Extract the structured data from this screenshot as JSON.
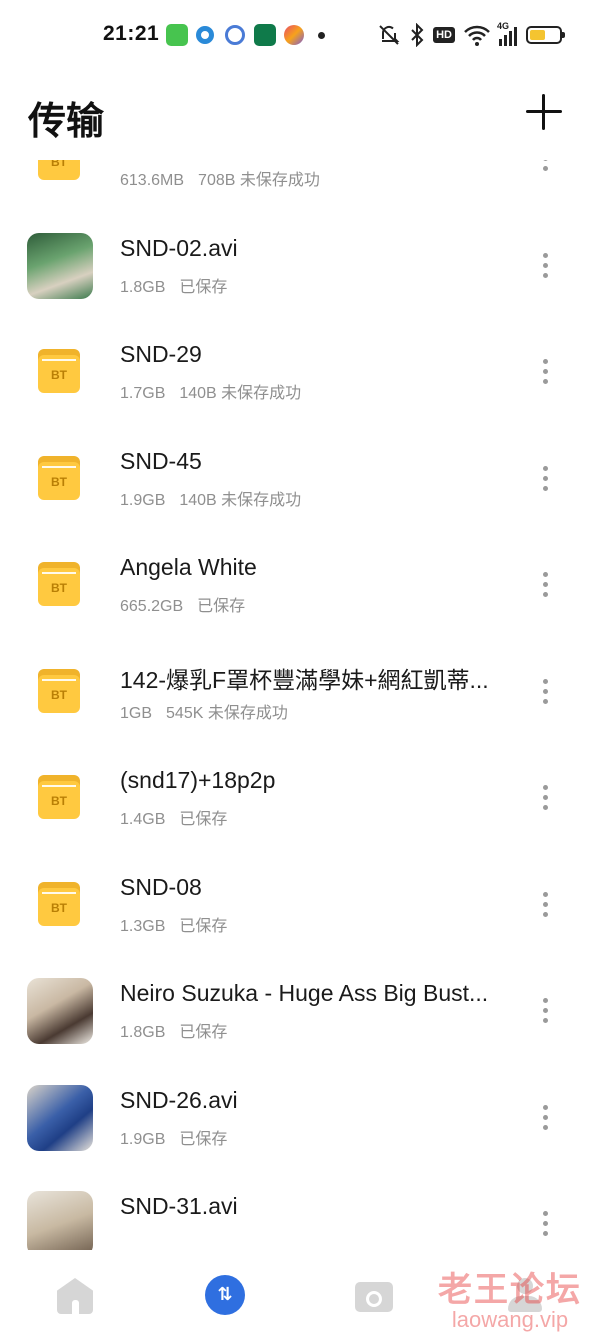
{
  "status_bar": {
    "time": "21:21",
    "network_label": "4G",
    "hd_label": "HD",
    "battery_level": 0.55,
    "icons": [
      "app-green-icon",
      "app-blue-icon",
      "app-cloud-icon",
      "oppo-icon",
      "app-colorful-icon",
      "mute-icon",
      "bluetooth-icon",
      "hd-icon",
      "wifi-icon",
      "signal-icon",
      "battery-icon"
    ]
  },
  "header": {
    "title": "传输",
    "add_icon": "plus-icon"
  },
  "items": [
    {
      "title": "",
      "size": "613.6MB",
      "status": "708B 未保存成功",
      "icon": "bt-folder"
    },
    {
      "title": "SND-02.avi",
      "size": "1.8GB",
      "status": "已保存",
      "icon": "video-thumbnail"
    },
    {
      "title": "SND-29",
      "size": "1.7GB",
      "status": "140B 未保存成功",
      "icon": "bt-folder"
    },
    {
      "title": "SND-45",
      "size": "1.9GB",
      "status": "140B 未保存成功",
      "icon": "bt-folder"
    },
    {
      "title": "Angela White",
      "size": "665.2GB",
      "status": "已保存",
      "icon": "bt-folder"
    },
    {
      "title": "142-爆乳F罩杯豐滿學妹+網紅凱蒂...",
      "size": "1GB",
      "status": "545K 未保存成功",
      "icon": "bt-folder"
    },
    {
      "title": "(snd17)+18p2p",
      "size": "1.4GB",
      "status": "已保存",
      "icon": "bt-folder"
    },
    {
      "title": "SND-08",
      "size": "1.3GB",
      "status": "已保存",
      "icon": "bt-folder"
    },
    {
      "title": "Neiro Suzuka - Huge Ass Big Bust...",
      "size": "1.8GB",
      "status": "已保存",
      "icon": "video-thumbnail"
    },
    {
      "title": "SND-26.avi",
      "size": "1.9GB",
      "status": "已保存",
      "icon": "video-thumbnail"
    },
    {
      "title": "SND-31.avi",
      "size": "",
      "status": "",
      "icon": "video-thumbnail"
    }
  ],
  "folder_badge": "BT",
  "bottom_nav": {
    "items": [
      "home-icon",
      "transfer-icon",
      "cloud-sync-icon",
      "profile-icon"
    ],
    "active": "transfer-icon",
    "active_glyph": "⇅"
  },
  "watermark": {
    "cn": "老王论坛",
    "en": "laowang.vip"
  },
  "colors": {
    "accent": "#2f6fe0",
    "folder": "#ffc940",
    "meta_text": "#8f8f8f"
  }
}
